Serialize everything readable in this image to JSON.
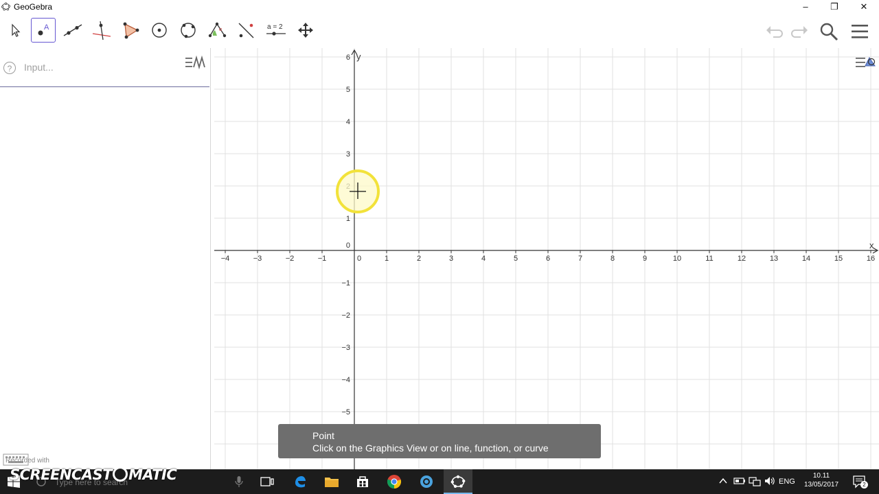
{
  "window": {
    "title": "GeoGebra",
    "controls": [
      "–",
      "❐",
      "✕"
    ]
  },
  "toolbar": {
    "tools": [
      "move",
      "point",
      "line",
      "perpendicular-line",
      "polygon",
      "circle-center",
      "circle-3points",
      "angle",
      "reflect",
      "slider",
      "move-graphics"
    ],
    "slider_label": "a = 2",
    "active_tool": "point"
  },
  "algebra": {
    "input_placeholder": "Input...",
    "help_glyph": "?"
  },
  "graphics": {
    "axes": {
      "x_label": "x",
      "y_label": "y"
    },
    "x_ticks": [
      "−4",
      "−3",
      "−2",
      "−1",
      "0",
      "1",
      "2",
      "3",
      "4",
      "5",
      "6",
      "7",
      "8",
      "9",
      "10",
      "11",
      "12",
      "13",
      "14",
      "15",
      "16"
    ],
    "y_ticks_pos": [
      "6",
      "5",
      "4",
      "3",
      "2",
      "1",
      "0"
    ],
    "y_ticks_neg": [
      "−1",
      "−2",
      "−3",
      "−4",
      "−5"
    ]
  },
  "tooltip": {
    "title": "Point",
    "text": "Click on the Graphics View or on line, function, or curve"
  },
  "taskbar": {
    "search_placeholder": "Type here to search",
    "language": "ENG",
    "time": "10.11",
    "date": "13/05/2017",
    "notification_count": "2"
  },
  "watermark": {
    "brand": "SCREENCAST",
    "brand2": "MATIC",
    "recorded": "Recorded with"
  },
  "colors": {
    "accent": "#6557d2",
    "grid": "#e0e0e0",
    "axis": "#333333",
    "cursor_ring": "#f2e23a"
  }
}
